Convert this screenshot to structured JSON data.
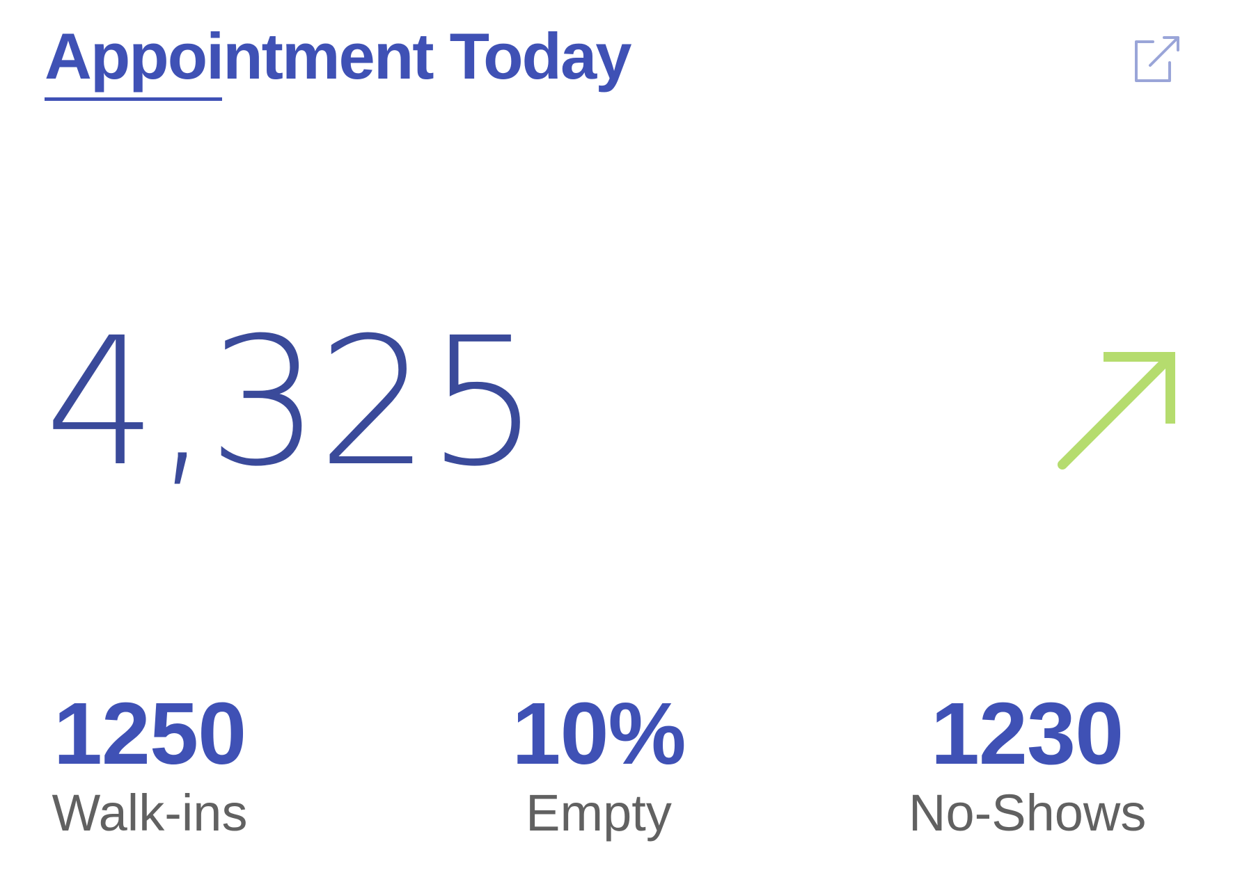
{
  "card": {
    "title": "Appointment Today",
    "open_icon": "open-in-new-icon",
    "total": "4,325",
    "trend_icon": "arrow-up-right-icon",
    "colors": {
      "accent": "#3f51b5",
      "big_number": "#3a4a9a",
      "trend": "#b5dc6e",
      "label": "#616161",
      "icon_muted": "#9aa5d8"
    }
  },
  "stats": [
    {
      "value": "1250",
      "label": "Walk-ins"
    },
    {
      "value": "10%",
      "label": "Empty"
    },
    {
      "value": "1230",
      "label": "No-Shows"
    }
  ]
}
